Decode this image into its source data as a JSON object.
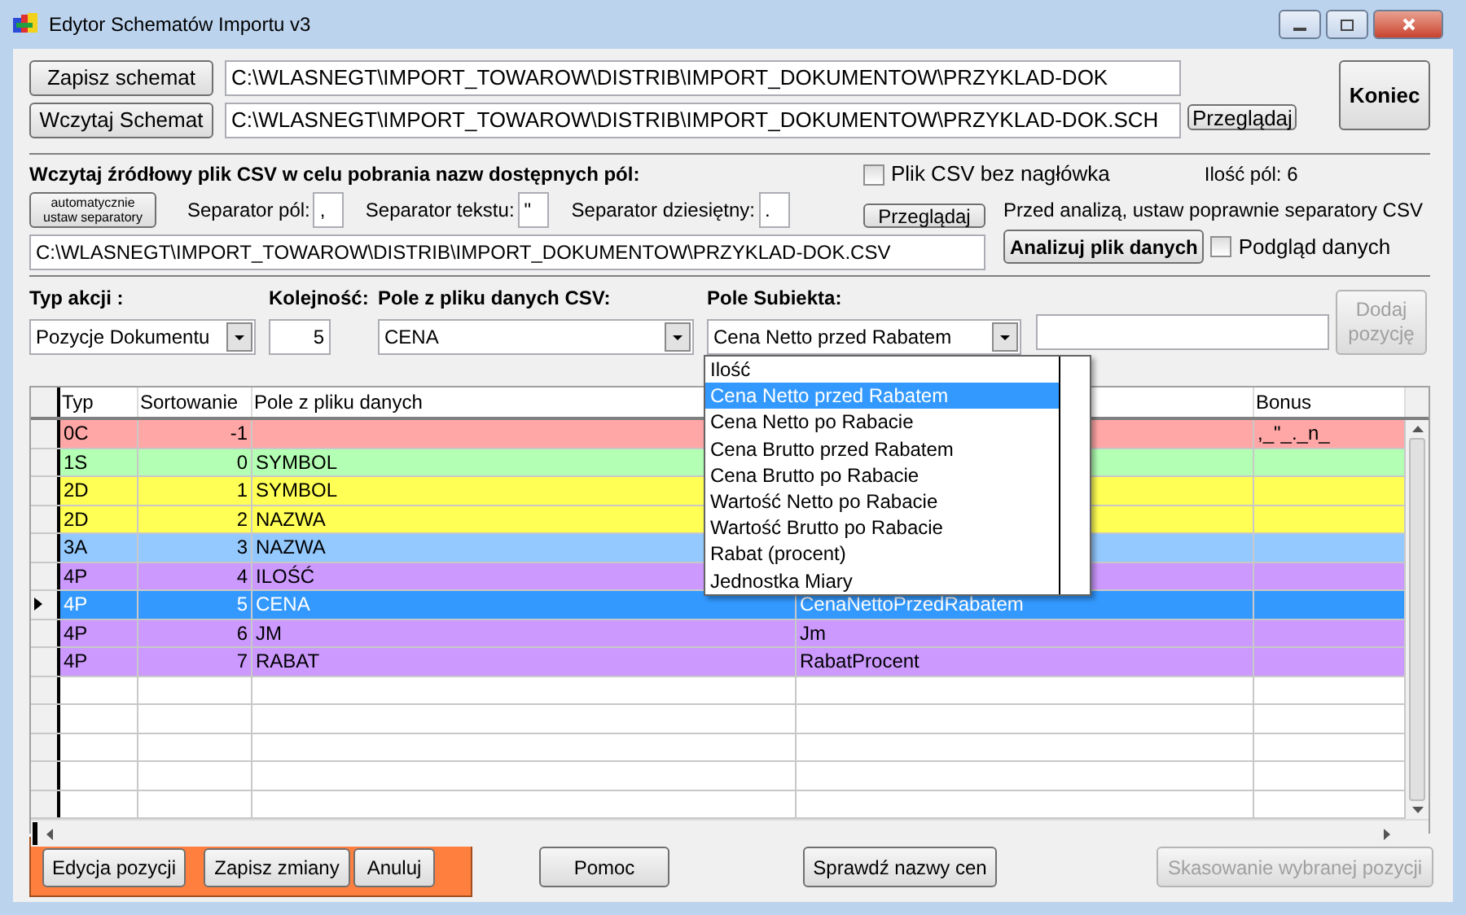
{
  "window": {
    "title": "Edytor Schematów Importu v3"
  },
  "schema": {
    "save_button": "Zapisz schemat",
    "save_path": "C:\\WLASNEGT\\IMPORT_TOWAROW\\DISTRIB\\IMPORT_DOKUMENTOW\\PRZYKLAD-DOK",
    "load_button": "Wczytaj Schemat",
    "load_path": "C:\\WLASNEGT\\IMPORT_TOWAROW\\DISTRIB\\IMPORT_DOKUMENTOW\\PRZYKLAD-DOK.SCH",
    "browse_button": "Przeglądaj",
    "close_button": "Koniec"
  },
  "csv": {
    "heading": "Wczytaj źródłowy plik CSV w celu pobrania nazw dostępnych pól:",
    "no_header": {
      "label": "Plik CSV bez nagłówka",
      "checked": false
    },
    "field_count": "Ilość pól: 6",
    "auto_button": [
      "automatycznie",
      "ustaw separatory"
    ],
    "separators": [
      {
        "label": "Separator pól:",
        "value": ","
      },
      {
        "label": "Separator tekstu:",
        "value": "\""
      },
      {
        "label": "Separator dziesiętny:",
        "value": "."
      }
    ],
    "browse_button": "Przeglądaj",
    "hint": "Przed analizą, ustaw poprawnie separatory CSV",
    "path": "C:\\WLASNEGT\\IMPORT_TOWAROW\\DISTRIB\\IMPORT_DOKUMENTOW\\PRZYKLAD-DOK.CSV",
    "analyze_button": "Analizuj plik danych",
    "preview": {
      "label": "Podgląd danych",
      "checked": false
    }
  },
  "position": {
    "action_type": {
      "label": "Typ akcji :",
      "value": "Pozycje Dokumentu"
    },
    "order": {
      "label": "Kolejność:",
      "value": "5"
    },
    "csv_field": {
      "label": "Pole z pliku danych CSV:",
      "value": "CENA"
    },
    "subject_field": {
      "label": "Pole Subiekta:",
      "value": "Cena Netto przed Rabatem"
    },
    "add_button": {
      "label": "Dodaj pozycję",
      "disabled": true
    }
  },
  "dropdown": {
    "items": [
      {
        "label": "Ilość",
        "selected": false
      },
      {
        "label": "Cena Netto przed Rabatem",
        "selected": true
      },
      {
        "label": "Cena Netto po Rabacie",
        "selected": false
      },
      {
        "label": "Cena Brutto przed Rabatem",
        "selected": false
      },
      {
        "label": "Cena Brutto po Rabacie",
        "selected": false
      },
      {
        "label": "Wartość Netto po Rabacie",
        "selected": false
      },
      {
        "label": "Wartość Brutto po Rabacie",
        "selected": false
      },
      {
        "label": "Rabat (procent)",
        "selected": false
      },
      {
        "label": "Jednostka Miary",
        "selected": false
      }
    ]
  },
  "table": {
    "columns": [
      "Typ",
      "Sortowanie",
      "Pole z pliku danych",
      "Bonus"
    ],
    "rows": [
      {
        "type": "0C",
        "sort": "-1",
        "bonus": ",_\"_._n_",
        "color": "#ffa6a6",
        "selected": false
      },
      {
        "type": "1S",
        "sort": "0",
        "csv_field": "SYMBOL",
        "color": "#b3ffb3",
        "selected": false
      },
      {
        "type": "2D",
        "sort": "1",
        "csv_field": "SYMBOL",
        "color": "#ffff55",
        "selected": false
      },
      {
        "type": "2D",
        "sort": "2",
        "csv_field": "NAZWA",
        "color": "#ffff55",
        "selected": false
      },
      {
        "type": "3A",
        "sort": "3",
        "csv_field": "NAZWA",
        "color": "#93c9ff",
        "selected": false
      },
      {
        "type": "4P",
        "sort": "4",
        "csv_field": "ILOŚĆ",
        "color": "#cc99ff",
        "selected": false
      },
      {
        "type": "4P",
        "sort": "5",
        "csv_field": "CENA",
        "column_4": "CenaNettoPrzedRabatem",
        "color": "#3399ff",
        "selected": true
      },
      {
        "type": "4P",
        "sort": "6",
        "csv_field": "JM",
        "column_4": "Jm",
        "color": "#cc99ff",
        "selected": false
      },
      {
        "type": "4P",
        "sort": "7",
        "csv_field": "RABAT",
        "column_4": "RabatProcent",
        "color": "#cc99ff",
        "selected": false
      }
    ]
  },
  "edit_buttons": [
    "Edycja pozycji",
    "Zapisz zmiany",
    "Anuluj"
  ],
  "help_button": "Pomoc",
  "check_button": "Sprawdź nazwy cen",
  "delete_button": {
    "label": "Skasowanie wybranej pozycji",
    "disabled": true
  }
}
